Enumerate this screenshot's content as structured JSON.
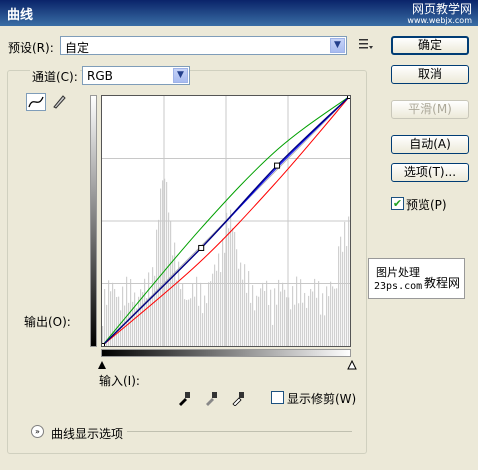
{
  "window": {
    "title": "曲线"
  },
  "watermark": {
    "line1": "网页教学网",
    "line2": "www.webjx.com"
  },
  "preset": {
    "label": "预设(R):",
    "value": "自定"
  },
  "channel": {
    "label": "通道(C):",
    "value": "RGB"
  },
  "graph": {
    "output_label": "输出(O):",
    "input_label": "输入(I):",
    "curves": {
      "rgb": {
        "color": "#000080",
        "points": [
          [
            0,
            0
          ],
          [
            102,
            100
          ],
          [
            180,
            184
          ],
          [
            255,
            255
          ]
        ]
      },
      "red": {
        "color": "#ff0000",
        "points": [
          [
            0,
            0
          ],
          [
            100,
            85
          ],
          [
            180,
            168
          ],
          [
            255,
            255
          ]
        ]
      },
      "green": {
        "color": "#00a000",
        "points": [
          [
            0,
            0
          ],
          [
            100,
            118
          ],
          [
            180,
            200
          ],
          [
            255,
            255
          ]
        ]
      },
      "blue": {
        "color": "#0000ff",
        "points": [
          [
            0,
            0
          ],
          [
            100,
            98
          ],
          [
            180,
            182
          ],
          [
            255,
            255
          ]
        ]
      }
    }
  },
  "buttons": {
    "ok": "确定",
    "cancel": "取消",
    "smooth": "平滑(M)",
    "auto": "自动(A)",
    "options": "选项(T)..."
  },
  "preview": {
    "label": "预览(P)",
    "checked": true
  },
  "show_clipping": {
    "label": "显示修剪(W)",
    "checked": false
  },
  "display_options": {
    "label": "曲线显示选项"
  },
  "overlay": {
    "line1": "图片处理",
    "line2": "23ps.com",
    "line3": "教程网"
  }
}
